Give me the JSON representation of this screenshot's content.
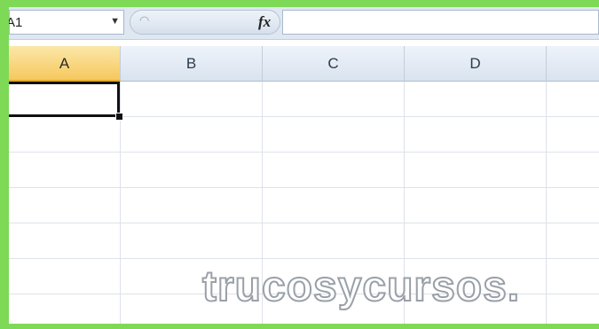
{
  "formula_bar": {
    "name_box": "A1",
    "name_box_arrow": "▼",
    "fx_label": "fx",
    "formula": ""
  },
  "columns": [
    "A",
    "B",
    "C",
    "D",
    ""
  ],
  "active_column": "A",
  "active_cell": "A1",
  "watermark": "trucosycursos."
}
